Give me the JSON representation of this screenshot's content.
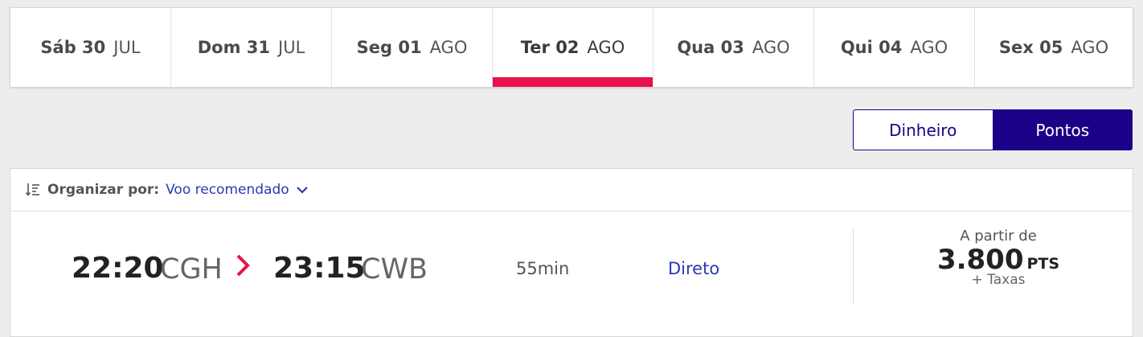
{
  "date_tabs": [
    {
      "day": "Sáb 30",
      "month": "JUL",
      "active": false
    },
    {
      "day": "Dom 31",
      "month": "JUL",
      "active": false
    },
    {
      "day": "Seg 01",
      "month": "AGO",
      "active": false
    },
    {
      "day": "Ter 02",
      "month": "AGO",
      "active": true
    },
    {
      "day": "Qua 03",
      "month": "AGO",
      "active": false
    },
    {
      "day": "Qui 04",
      "month": "AGO",
      "active": false
    },
    {
      "day": "Sex 05",
      "month": "AGO",
      "active": false
    }
  ],
  "currency_toggle": {
    "money_label": "Dinheiro",
    "points_label": "Pontos",
    "selected": "Pontos"
  },
  "sort": {
    "label": "Organizar por:",
    "value": "Voo recomendado"
  },
  "flight": {
    "departure_time": "22:20",
    "departure_airport": "CGH",
    "arrival_time": "23:15",
    "arrival_airport": "CWB",
    "duration": "55min",
    "stops": "Direto",
    "price_from": "A partir de",
    "price_amount": "3.800",
    "price_unit": "PTS",
    "price_tax": "+ Taxas"
  },
  "colors": {
    "accent": "#e8114b",
    "brand": "#1b0088",
    "link": "#2a39b0"
  }
}
